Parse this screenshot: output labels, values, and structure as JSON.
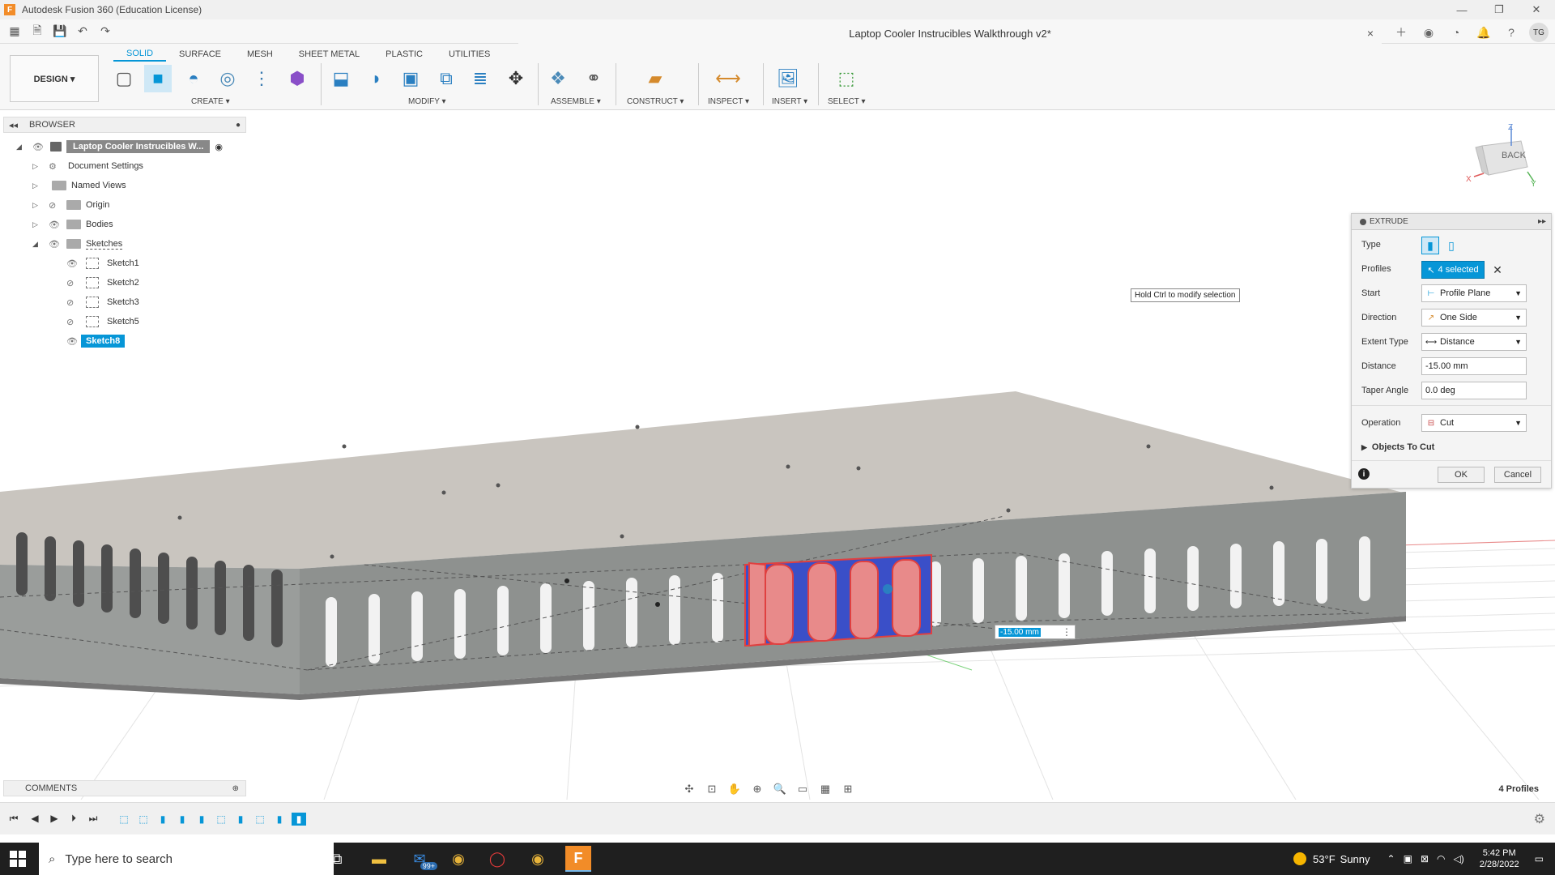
{
  "window": {
    "title": "Autodesk Fusion 360 (Education License)",
    "app_logo": "F",
    "minimize": "—",
    "restore": "❐",
    "close": "✕"
  },
  "document": {
    "title": "Laptop Cooler Instrucibles Walkthrough v2*",
    "close": "×"
  },
  "user_initials": "TG",
  "toolbar": {
    "tabs": [
      "SOLID",
      "SURFACE",
      "MESH",
      "SHEET METAL",
      "PLASTIC",
      "UTILITIES"
    ],
    "active_tab": "SOLID",
    "workspace": "DESIGN ▾",
    "groups": {
      "create": "CREATE ▾",
      "modify": "MODIFY ▾",
      "assemble": "ASSEMBLE ▾",
      "construct": "CONSTRUCT ▾",
      "inspect": "INSPECT ▾",
      "insert": "INSERT ▾",
      "select": "SELECT ▾"
    }
  },
  "browser": {
    "header": "BROWSER",
    "root": "Laptop Cooler Instrucibles W...",
    "items": [
      {
        "label": "Document Settings"
      },
      {
        "label": "Named Views"
      },
      {
        "label": "Origin"
      },
      {
        "label": "Bodies"
      },
      {
        "label": "Sketches"
      }
    ],
    "sketches": [
      "Sketch1",
      "Sketch2",
      "Sketch3",
      "Sketch5",
      "Sketch8"
    ],
    "selected_sketch": "Sketch8"
  },
  "viewcube": {
    "face": "BACK",
    "axis_z": "Z",
    "axis_x": "X",
    "axis_y": "Y"
  },
  "tooltip": "Hold Ctrl to modify selection",
  "dimension_input": "-15.00 mm",
  "extrude": {
    "title": "EXTRUDE",
    "type_label": "Type",
    "profiles_label": "Profiles",
    "profiles_value": "4 selected",
    "start_label": "Start",
    "start_value": "Profile Plane",
    "direction_label": "Direction",
    "direction_value": "One Side",
    "extent_label": "Extent Type",
    "extent_value": "Distance",
    "distance_label": "Distance",
    "distance_value": "-15.00 mm",
    "taper_label": "Taper Angle",
    "taper_value": "0.0 deg",
    "operation_label": "Operation",
    "operation_value": "Cut",
    "objects_to_cut": "Objects To Cut",
    "ok": "OK",
    "cancel": "Cancel"
  },
  "comments": "COMMENTS",
  "status_profiles": "4 Profiles",
  "taskbar": {
    "search_placeholder": "Type here to search",
    "weather_temp": "53°F",
    "weather_desc": "Sunny",
    "time": "5:42 PM",
    "date": "2/28/2022",
    "mail_badge": "99+"
  },
  "colors": {
    "accent": "#0696d7",
    "body_top": "#c9c5bf",
    "body_side": "#8e918f",
    "profile_red": "#e88a8a",
    "profile_blue": "#3a4fc8"
  }
}
